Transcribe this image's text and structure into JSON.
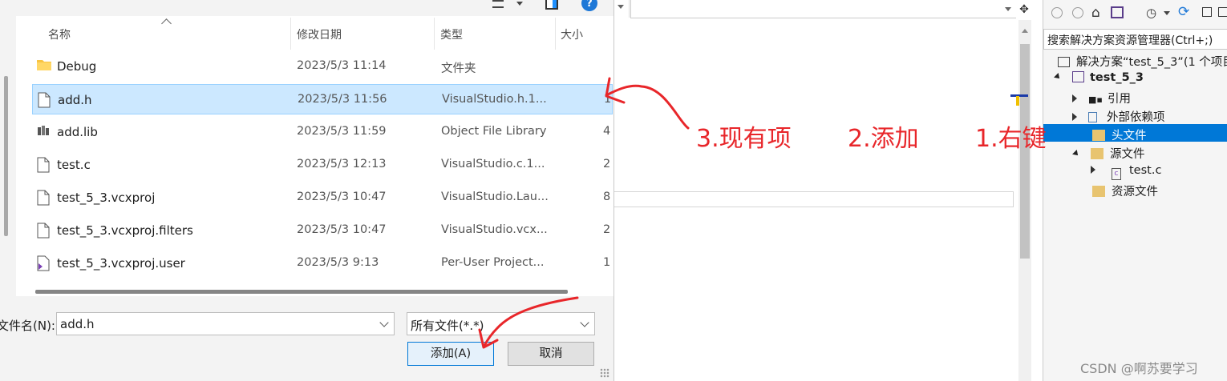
{
  "dialog": {
    "columns": {
      "name": "名称",
      "date": "修改日期",
      "type": "类型",
      "size": "大小"
    },
    "files": [
      {
        "name": "Debug",
        "date": "2023/5/3 11:14",
        "type": "文件夹",
        "size": "",
        "icon": "folder-icon"
      },
      {
        "name": "add.h",
        "date": "2023/5/3 11:56",
        "type": "VisualStudio.h.1...",
        "size": "1",
        "icon": "file-icon",
        "selected": true
      },
      {
        "name": "add.lib",
        "date": "2023/5/3 11:59",
        "type": "Object File Library",
        "size": "4",
        "icon": "library-file-icon"
      },
      {
        "name": "test.c",
        "date": "2023/5/3 12:13",
        "type": "VisualStudio.c.1...",
        "size": "2",
        "icon": "file-icon"
      },
      {
        "name": "test_5_3.vcxproj",
        "date": "2023/5/3 10:47",
        "type": "VisualStudio.Lau...",
        "size": "8",
        "icon": "file-icon"
      },
      {
        "name": "test_5_3.vcxproj.filters",
        "date": "2023/5/3 10:47",
        "type": "VisualStudio.vcx...",
        "size": "2",
        "icon": "file-icon"
      },
      {
        "name": "test_5_3.vcxproj.user",
        "date": "2023/5/3 9:13",
        "type": "Per-User Project...",
        "size": "1",
        "icon": "vs-user-file-icon"
      }
    ],
    "filename_label": "文件名(N):",
    "filename_value": "add.h",
    "filetype_value": "所有文件(*.*)",
    "add_button": "添加(A)",
    "cancel_button": "取消"
  },
  "annotations": {
    "step3": "3.现有项",
    "step2": "2.添加",
    "step1": "1.右键"
  },
  "solution_explorer": {
    "search_placeholder": "搜索解决方案资源管理器(Ctrl+;)",
    "solution": "解决方案“test_5_3”(1 个项目",
    "project": "test_5_3",
    "items": [
      "引用",
      "外部依赖项",
      "头文件",
      "源文件",
      "test.c",
      "资源文件"
    ]
  },
  "watermark": "CSDN @啊苏要学习",
  "colors": {
    "selection": "#cce8ff",
    "accent": "#0078d7",
    "annotation": "#e8262a"
  }
}
